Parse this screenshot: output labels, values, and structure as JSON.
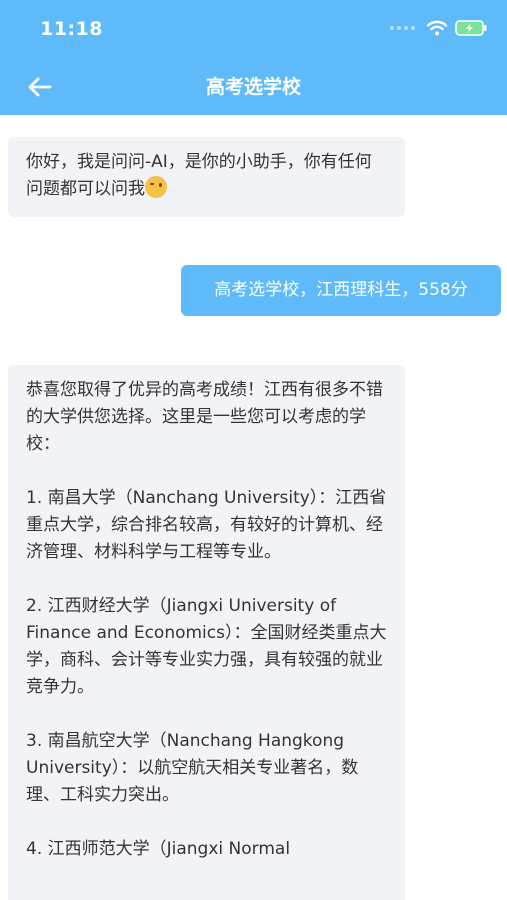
{
  "status_bar": {
    "time": "11:18"
  },
  "nav": {
    "title": "高考选学校"
  },
  "messages": {
    "greeting": "你好，我是问问-AI，是你的小助手，你有任何问题都可以问我",
    "user_query": "高考选学校，江西理科生，558分",
    "reply_intro": "恭喜您取得了优异的高考成绩！江西有很多不错的大学供您选择。这里是一些您可以考虑的学校：",
    "reply_item1": "1. 南昌大学（Nanchang University）：江西省重点大学，综合排名较高，有较好的计算机、经济管理、材料科学与工程等专业。",
    "reply_item2": "2. 江西财经大学（Jiangxi University of Finance and Economics）：全国财经类重点大学，商科、会计等专业实力强，具有较强的就业竞争力。",
    "reply_item3": "3. 南昌航空大学（Nanchang Hangkong University）：以航空航天相关专业著名，数理、工科实力突出。",
    "reply_item4": "4. 江西师范大学（Jiangxi Normal"
  },
  "colors": {
    "accent": "#5ebaf8",
    "bot_bubble": "#f2f3f6"
  },
  "icons": {
    "back": "arrow-left-icon",
    "wifi": "wifi-icon",
    "battery": "battery-charging-icon",
    "emoji": "winking-face-emoji"
  }
}
